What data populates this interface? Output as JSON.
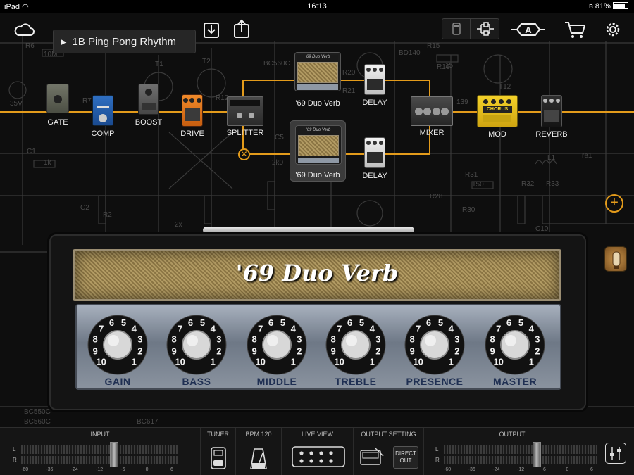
{
  "status": {
    "device": "iPad",
    "time": "16:13",
    "battery": "81%"
  },
  "toolbar": {
    "preset_name": "1B Ping Pong Rhythm"
  },
  "chain": [
    {
      "id": "gate",
      "label": "GATE"
    },
    {
      "id": "comp",
      "label": "COMP"
    },
    {
      "id": "boost",
      "label": "BOOST"
    },
    {
      "id": "drive",
      "label": "DRIVE"
    },
    {
      "id": "splitter",
      "label": "SPLITTER"
    },
    {
      "id": "amp_a",
      "label": "'69 Duo Verb"
    },
    {
      "id": "delay_a",
      "label": "DELAY"
    },
    {
      "id": "amp_b",
      "label": "'69 Duo Verb"
    },
    {
      "id": "delay_b",
      "label": "DELAY"
    },
    {
      "id": "mixer",
      "label": "MIXER"
    },
    {
      "id": "mod",
      "label": "MOD"
    },
    {
      "id": "reverb",
      "label": "REVERB"
    }
  ],
  "pedal_text": {
    "chorus": "CHORUS",
    "amp_small": "'69 Duo Verb"
  },
  "amp": {
    "name": "'69 Duo Verb",
    "knobs": [
      {
        "label": "GAIN",
        "nums": [
          "10",
          "9",
          "8",
          "7",
          "6",
          "5",
          "4",
          "3",
          "2",
          "1"
        ]
      },
      {
        "label": "BASS",
        "nums": [
          "10",
          "9",
          "8",
          "7",
          "6",
          "5",
          "4",
          "3",
          "2",
          "1"
        ]
      },
      {
        "label": "MIDDLE",
        "nums": [
          "10",
          "9",
          "8",
          "7",
          "6",
          "5",
          "4",
          "3",
          "2",
          "1"
        ]
      },
      {
        "label": "TREBLE",
        "nums": [
          "10",
          "9",
          "8",
          "7",
          "6",
          "5",
          "4",
          "3",
          "2",
          "1"
        ]
      },
      {
        "label": "PRESENCE",
        "nums": [
          "10",
          "9",
          "8",
          "7",
          "6",
          "5",
          "4",
          "3",
          "2",
          "1"
        ]
      },
      {
        "label": "MASTER",
        "nums": [
          "10",
          "9",
          "8",
          "7",
          "6",
          "5",
          "4",
          "3",
          "2",
          "1"
        ]
      }
    ]
  },
  "bottom": {
    "input": "INPUT",
    "tuner": "TUNER",
    "bpm": "BPM 120",
    "live_view": "LIVE VIEW",
    "output_setting": "OUTPUT SETTING",
    "direct_out": "DIRECT OUT",
    "output": "OUTPUT",
    "L": "L",
    "R": "R",
    "scale": [
      "-60",
      "-36",
      "-24",
      "-12",
      "-6",
      "0",
      "6"
    ]
  },
  "schematic_text": [
    "35V",
    "10M",
    "R6",
    "R7",
    "R8",
    "R12",
    "R20",
    "R21",
    "R15",
    "R16",
    "BC560C",
    "BD140",
    "BD139",
    "C1",
    "C2",
    "C5",
    "C10",
    "R2",
    "R31",
    "R32",
    "R33",
    "R28",
    "R30",
    "1k",
    "15",
    "2k0",
    "150",
    "2x",
    "BC550C",
    "BC617",
    "re1",
    "L1",
    "139",
    "T1",
    "T2",
    "T11",
    "T12"
  ]
}
